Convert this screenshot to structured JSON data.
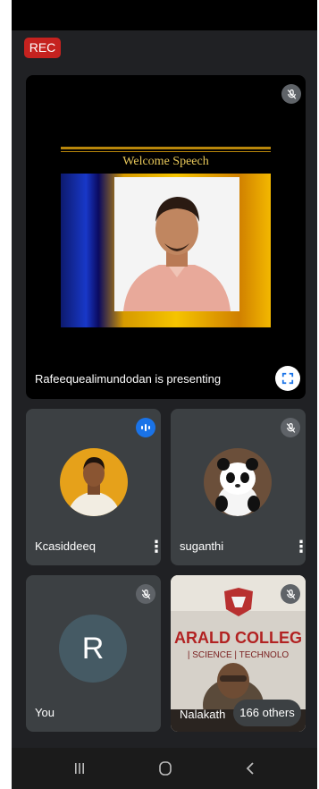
{
  "recording": {
    "label": "REC"
  },
  "presentation": {
    "slide_title": "Welcome Speech",
    "caption": "Rafeequealimundodan is presenting"
  },
  "participants": [
    {
      "name": "Kcasiddeeq",
      "mic": "speaking"
    },
    {
      "name": "suganthi",
      "mic": "muted"
    },
    {
      "name": "You",
      "mic": "muted",
      "avatar_letter": "R"
    },
    {
      "name": "Nalakath",
      "mic": "muted",
      "video_text": "ARALD COLLEG",
      "video_subtext": "| SCIENCE | TECHNOLO"
    }
  ],
  "others": {
    "label": "166 others"
  },
  "colors": {
    "background": "#202124",
    "tile": "#3c4043",
    "rec": "#c5221f",
    "speaking": "#1a73e8",
    "avatar": "#455a64"
  },
  "icons": {
    "mic_off": "mic-off-icon",
    "speaking": "audio-level-icon",
    "fullscreen": "fullscreen-icon",
    "more": "more-vert-icon",
    "nav": [
      "recent-apps-icon",
      "home-icon",
      "back-icon"
    ]
  }
}
